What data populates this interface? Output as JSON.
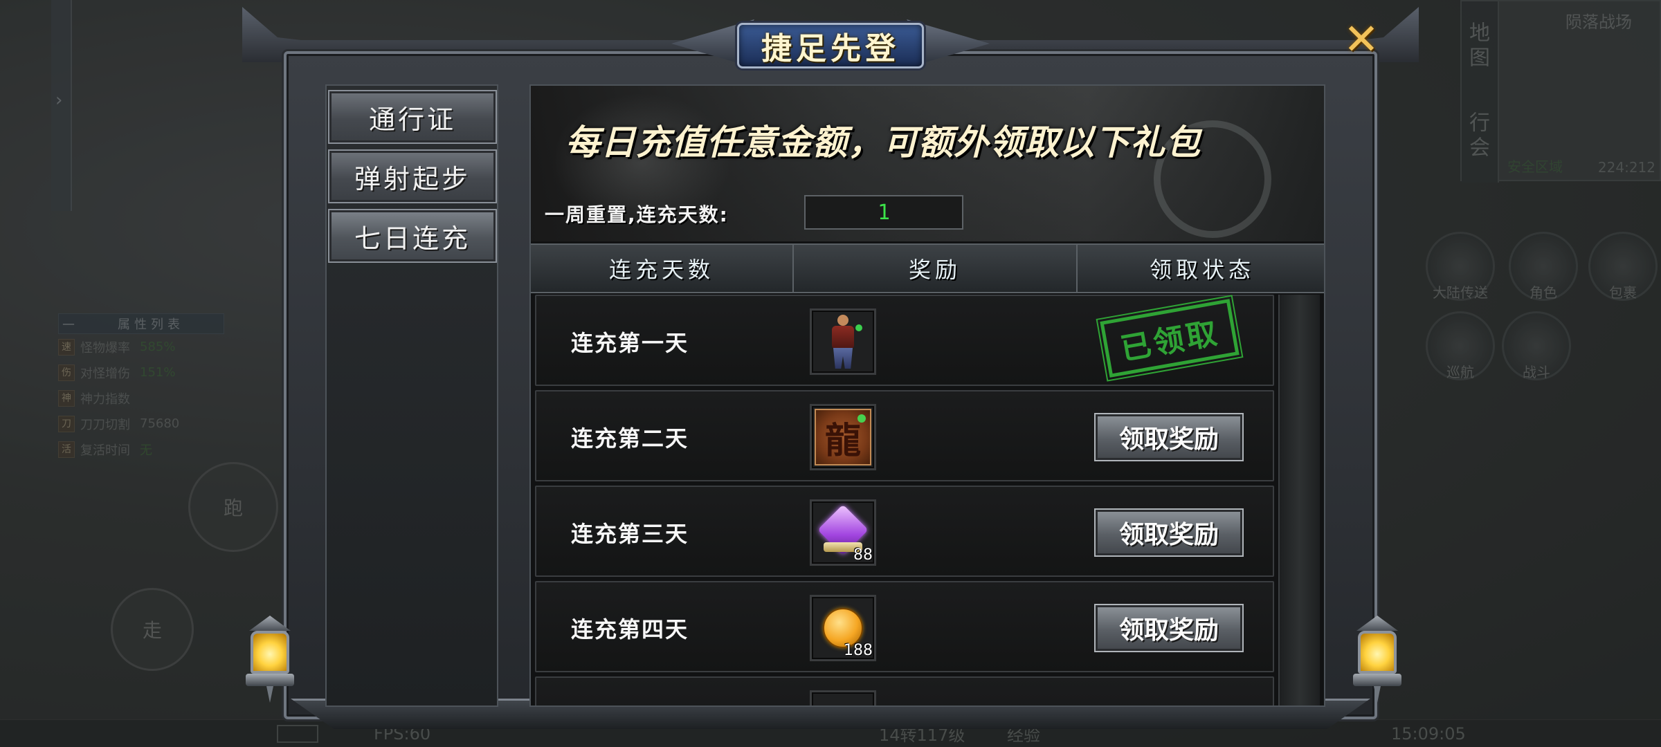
{
  "dialog": {
    "title": "捷足先登",
    "close_icon": "close-x-icon"
  },
  "side_tabs": [
    {
      "label": "通行证",
      "active": false
    },
    {
      "label": "弹射起步",
      "active": false
    },
    {
      "label": "七日连充",
      "active": true
    }
  ],
  "banner": {
    "headline": "每日充值任意金额，可额外领取以下礼包",
    "reset_label": "一周重置,连充天数:",
    "consecutive_days": "1"
  },
  "table": {
    "headers": [
      "连充天数",
      "奖励",
      "领取状态"
    ],
    "rows": [
      {
        "day": "连充第一天",
        "reward_icon": "warrior-figure-icon",
        "count": "",
        "status": "claimed",
        "status_label": "已领取"
      },
      {
        "day": "连充第二天",
        "reward_icon": "dragon-tome-icon",
        "count": "",
        "status": "claimable",
        "status_label": "领取奖励"
      },
      {
        "day": "连充第三天",
        "reward_icon": "purple-crystal-icon",
        "count": "88",
        "status": "claimable",
        "status_label": "领取奖励"
      },
      {
        "day": "连充第四天",
        "reward_icon": "gold-coin-icon",
        "count": "188",
        "status": "claimable",
        "status_label": "领取奖励"
      }
    ]
  },
  "background": {
    "minimap": {
      "zone_name": "陨落战场",
      "tab_map": "地图",
      "tab_guild": "行会",
      "coordinates": "224:212",
      "safe_zone": "安全区域"
    },
    "attr_panel": {
      "title": "属性列表",
      "rows": [
        {
          "icon": "速",
          "label": "怪物爆率",
          "value": "585%"
        },
        {
          "icon": "伤",
          "label": "对怪增伤",
          "value": "151%"
        },
        {
          "icon": "神",
          "label": "神力指数",
          "value": ""
        },
        {
          "icon": "刀",
          "label": "刀刀切割",
          "value": "75680"
        },
        {
          "icon": "活",
          "label": "复活时间",
          "value": "无"
        }
      ]
    },
    "joystick": {
      "run": "跑",
      "walk": "走"
    },
    "round_buttons": [
      "大陆传送",
      "角色",
      "包裹",
      "巡航",
      "战斗"
    ],
    "status": {
      "fps": "FPS:60",
      "level": "14转117级",
      "exp_label": "经验",
      "time": "15:09:05"
    }
  },
  "colors": {
    "accent_gold": "#f2c25a",
    "green_value": "#3ce44a",
    "stamp_green": "#2fa335"
  }
}
